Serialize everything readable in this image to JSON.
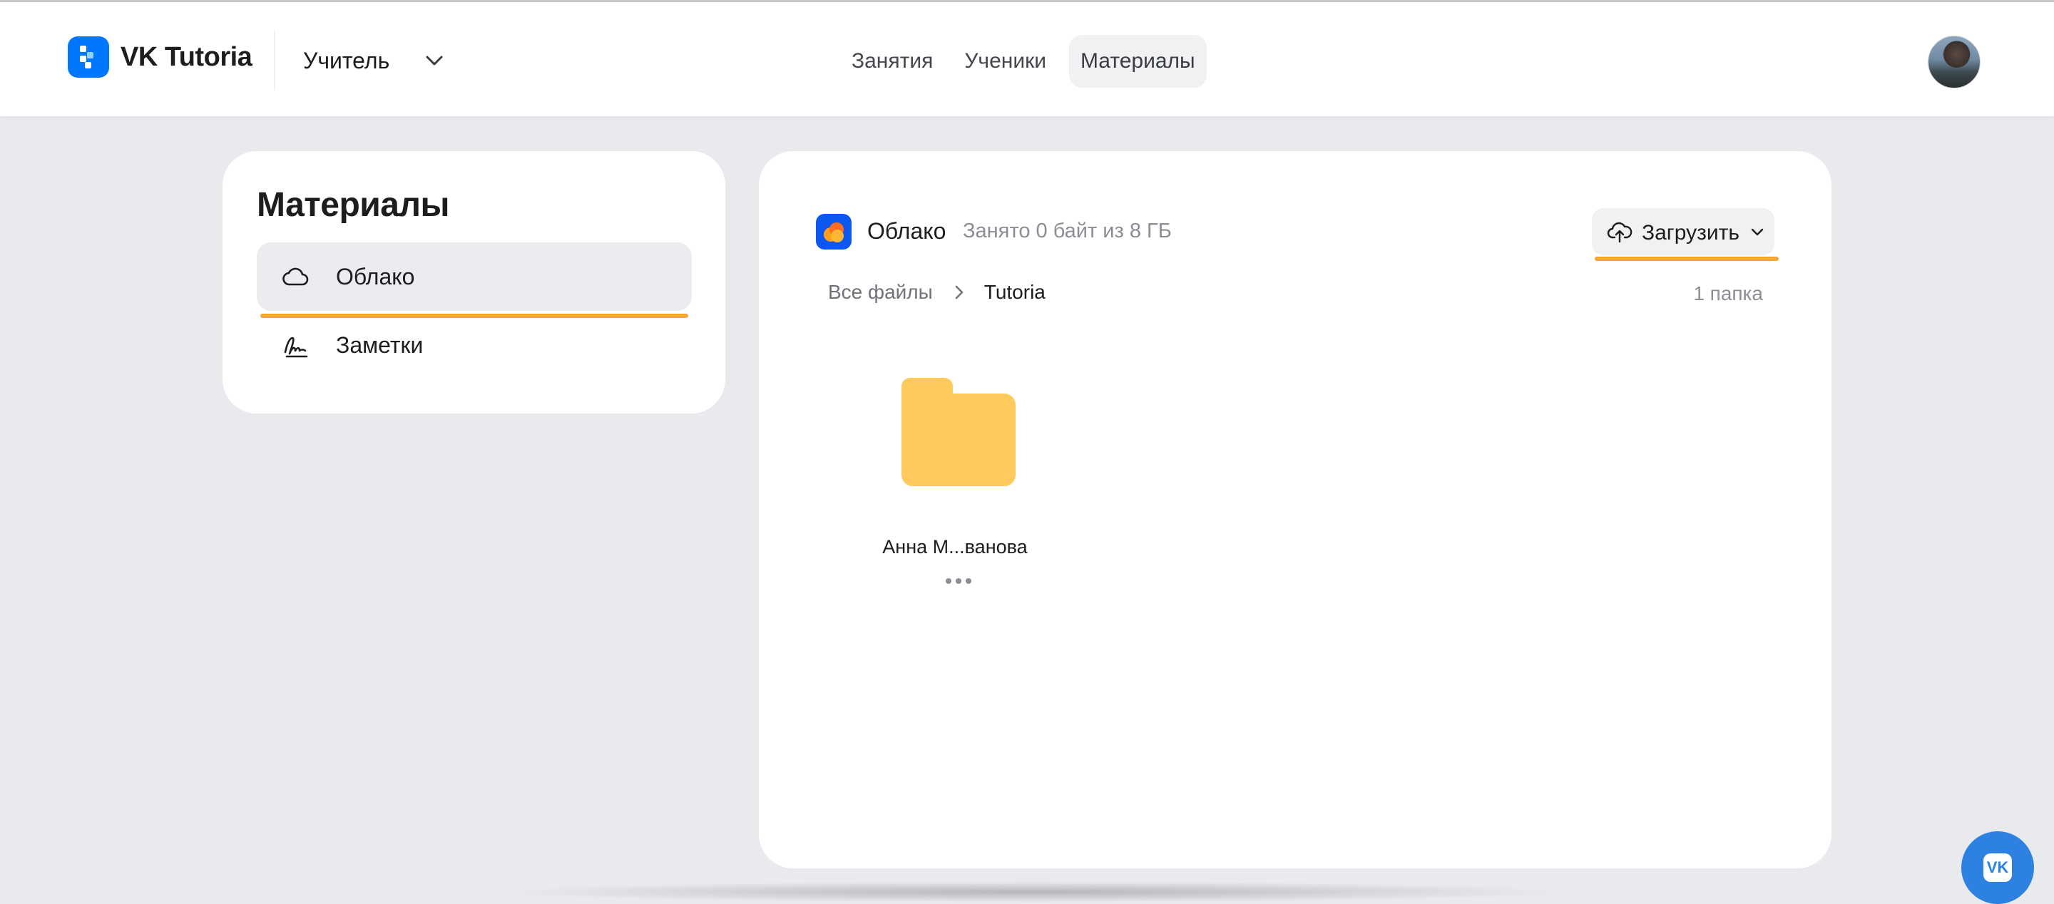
{
  "header": {
    "brand": "VK Tutoria",
    "role_selector": {
      "value": "Учитель"
    },
    "nav": [
      {
        "label": "Занятия",
        "active": false
      },
      {
        "label": "Ученики",
        "active": false
      },
      {
        "label": "Материалы",
        "active": true
      }
    ]
  },
  "sidebar": {
    "title": "Материалы",
    "items": [
      {
        "label": "Облако",
        "icon": "cloud-icon",
        "active": true
      },
      {
        "label": "Заметки",
        "icon": "signature-icon",
        "active": false
      }
    ]
  },
  "main": {
    "storage_name": "Облако",
    "storage_usage": "Занято 0 байт из 8 ГБ",
    "upload_label": "Загрузить",
    "breadcrumb": {
      "root": "Все файлы",
      "current": "Tutoria"
    },
    "items_count": "1 папка",
    "folders": [
      {
        "name": "Анна М...ванова"
      }
    ]
  },
  "colors": {
    "accent_orange": "#f5a43a",
    "folder_yellow": "#ffc95c",
    "brand_blue": "#0077ff",
    "vk_blue": "#2d81e0"
  },
  "fab": {
    "label": "VK"
  }
}
